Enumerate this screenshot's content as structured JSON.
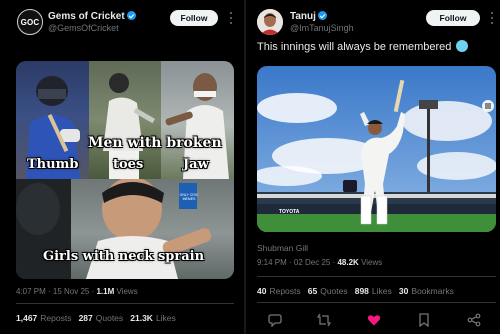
{
  "left_post": {
    "author_name": "Gems of Cricket",
    "author_handle": "@GemsOfCricket",
    "avatar_text": "GOC",
    "follow_label": "Follow",
    "meme": {
      "thumb_label": "Thumb",
      "broken_label_line1": "Men with broken",
      "broken_label_line2": "toes",
      "jaw_label": "Jaw",
      "girls_label": "Girls with neck sprain",
      "watermark": "ONLY CRIC MEMES"
    },
    "timestamp": "4:07 PM · 15 Nov 25 · ",
    "views_count": "1.1M",
    "views_label": " Views",
    "stats": [
      {
        "value": "1,467",
        "label": "Reposts"
      },
      {
        "value": "287",
        "label": "Quotes"
      },
      {
        "value": "21.3K",
        "label": "Likes"
      }
    ]
  },
  "right_post": {
    "author_name": "Tanuj",
    "author_handle": "@ImTanujSingh",
    "follow_label": "Follow",
    "text": "This innings will always be remembered",
    "emoji": "cold-face-emoji",
    "banner_text": "TOYOTA",
    "caption": "Shubman Gill",
    "timestamp": "9:14 PM · 02 Dec 25 · ",
    "views_count": "48.2K",
    "views_label": " Views",
    "stats": [
      {
        "value": "40",
        "label": "Reposts"
      },
      {
        "value": "65",
        "label": "Quotes"
      },
      {
        "value": "898",
        "label": "Likes"
      },
      {
        "value": "30",
        "label": "Bookmarks"
      }
    ],
    "actions": [
      "reply-icon",
      "repost-icon",
      "like-icon",
      "bookmark-icon",
      "share-icon"
    ]
  },
  "colors": {
    "background": "#000000",
    "accent": "#1d9bf0",
    "like": "#f91880",
    "muted": "#71767b"
  }
}
